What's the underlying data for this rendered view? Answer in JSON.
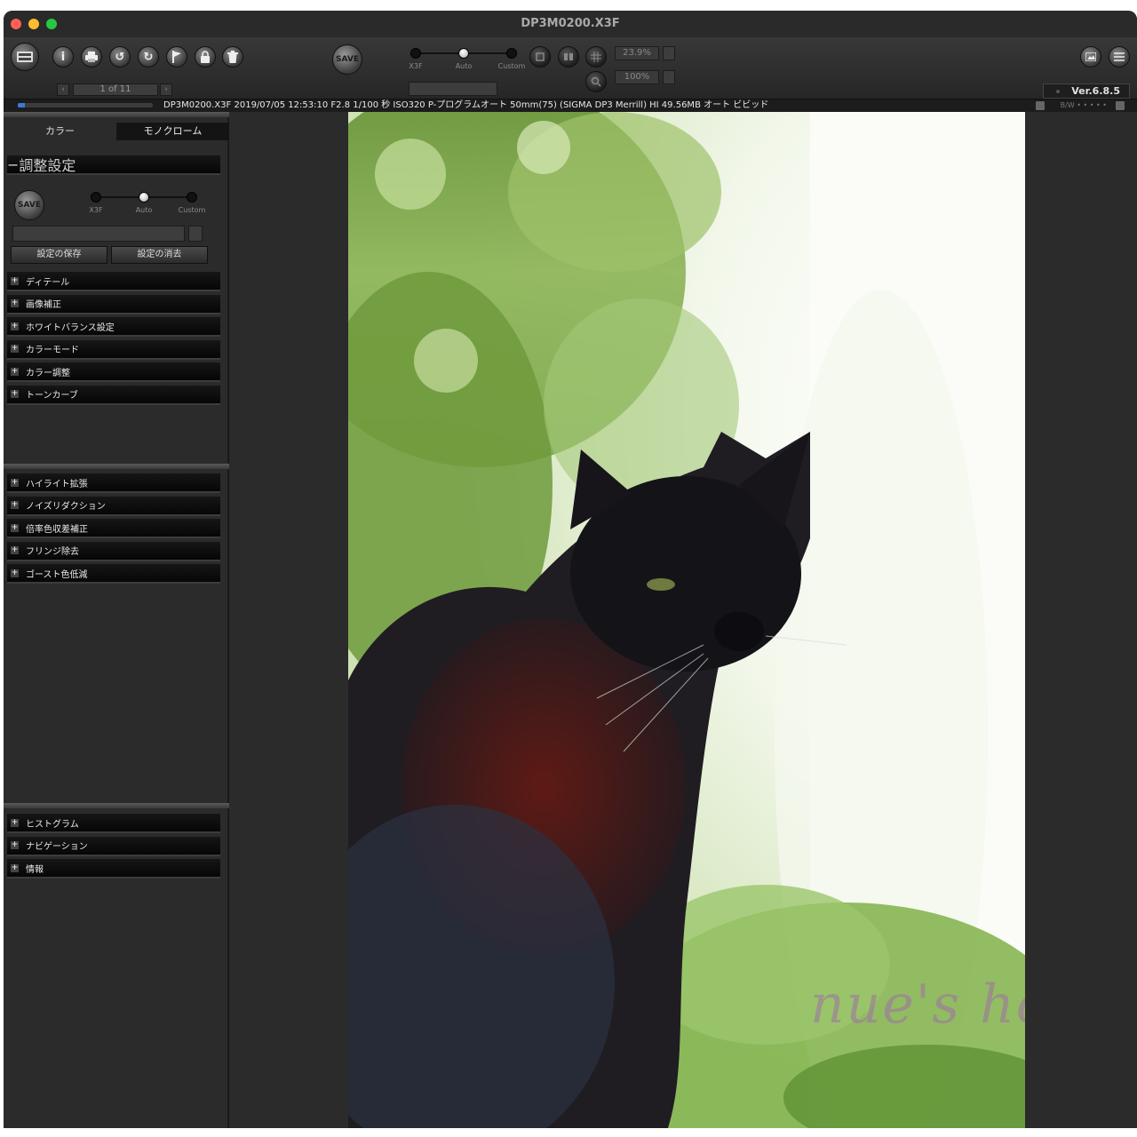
{
  "window": {
    "title": "DP3M0200.X3F"
  },
  "toolbar": {
    "pager": "1 of 11",
    "save_label": "SAVE",
    "mode_labels": [
      "X3F",
      "Auto",
      "Custom"
    ],
    "zoom_value": "23.9%",
    "scale_value": "100%",
    "version": "Ver.6.8.5",
    "icons": [
      "sigma-logo-icon",
      "info-icon",
      "print-icon",
      "rotate-left-icon",
      "rotate-right-icon",
      "flag-icon",
      "lock-icon",
      "trash-icon",
      "crop-icon",
      "split-view-icon",
      "grid-icon",
      "loupe-icon",
      "image-view-icon",
      "list-view-icon"
    ]
  },
  "infobar": {
    "progress": 0.05,
    "text": "DP3M0200.X3F 2019/07/05 12:53:10 F2.8 1/100 秒 ISO320 P-プログラムオート 50mm(75) (SIGMA DP3 Merrill) HI 49.56MB オート ビビッド",
    "bw": "B/W • • • • •"
  },
  "sidebar": {
    "tabs": [
      "カラー",
      "モノクローム"
    ],
    "adjust_header": "調整設定",
    "save_label": "SAVE",
    "mode_labels": [
      "X3F",
      "Auto",
      "Custom"
    ],
    "save_settings": "設定の保存",
    "delete_settings": "設定の消去",
    "group1": [
      "ディテール",
      "画像補正",
      "ホワイトバランス設定",
      "カラーモード",
      "カラー調整",
      "トーンカーブ"
    ],
    "group2": [
      "ハイライト拡張",
      "ノイズリダクション",
      "倍率色収差補正",
      "フリンジ除去",
      "ゴースト色低減"
    ],
    "group3": [
      "ヒストグラム",
      "ナビゲーション",
      "情報"
    ]
  },
  "viewer": {
    "watermark": "nue's hobby"
  },
  "colors": {
    "accent": "#3a7bd5",
    "window_bg": "#2b2b2b",
    "row_bg": "#0d0d0d"
  }
}
